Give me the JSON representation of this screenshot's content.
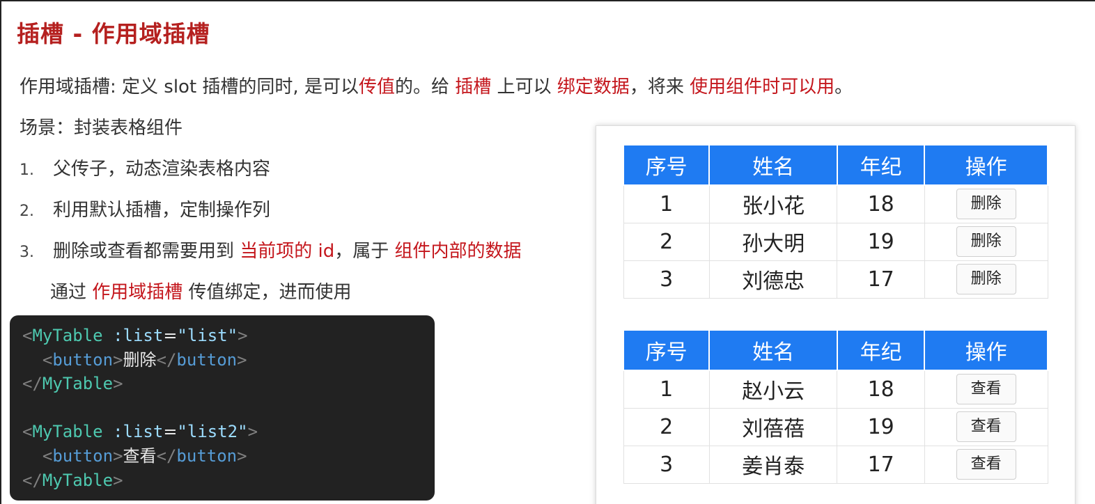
{
  "title": "插槽 - 作用域插槽",
  "intro": {
    "p1": "作用域插槽: 定义 slot 插槽的同时, 是可以",
    "p2": "传值",
    "p3": "的。给 ",
    "p4": "插槽",
    "p5": " 上可以 ",
    "p6": "绑定数据",
    "p7": "，将来 ",
    "p8": "使用组件时可以用",
    "p9": "。"
  },
  "scene": "场景：封装表格组件",
  "steps": [
    {
      "num": "1.",
      "text": "父传子，动态渲染表格内容"
    },
    {
      "num": "2.",
      "text": "利用默认插槽，定制操作列"
    },
    {
      "num": "3.",
      "a": "删除或查看都需要用到 ",
      "b": "当前项的 id",
      "c": "，属于 ",
      "d": "组件内部的数据"
    }
  ],
  "step4": {
    "a": "通过 ",
    "b": "作用域插槽",
    "c": " 传值绑定，进而使用"
  },
  "code": {
    "lt": "<",
    "gt": ">",
    "close_lt": "</",
    "tag": "MyTable",
    "button_tag": "button",
    "attr": ":list",
    "eq": "=",
    "val1": "\"list\"",
    "val2": "\"list2\"",
    "btn1": "删除",
    "btn2": "查看"
  },
  "table_headers": [
    "序号",
    "姓名",
    "年纪",
    "操作"
  ],
  "table1": {
    "rows": [
      {
        "id": "1",
        "name": "张小花",
        "age": "18",
        "action": "删除"
      },
      {
        "id": "2",
        "name": "孙大明",
        "age": "19",
        "action": "删除"
      },
      {
        "id": "3",
        "name": "刘德忠",
        "age": "17",
        "action": "删除"
      }
    ]
  },
  "table2": {
    "rows": [
      {
        "id": "1",
        "name": "赵小云",
        "age": "18",
        "action": "查看"
      },
      {
        "id": "2",
        "name": "刘蓓蓓",
        "age": "19",
        "action": "查看"
      },
      {
        "id": "3",
        "name": "姜肖泰",
        "age": "17",
        "action": "查看"
      }
    ]
  },
  "colors": {
    "title": "#b5201f",
    "highlight": "#c4161c",
    "table_header": "#1f7bf2",
    "code_bg": "#222222"
  }
}
